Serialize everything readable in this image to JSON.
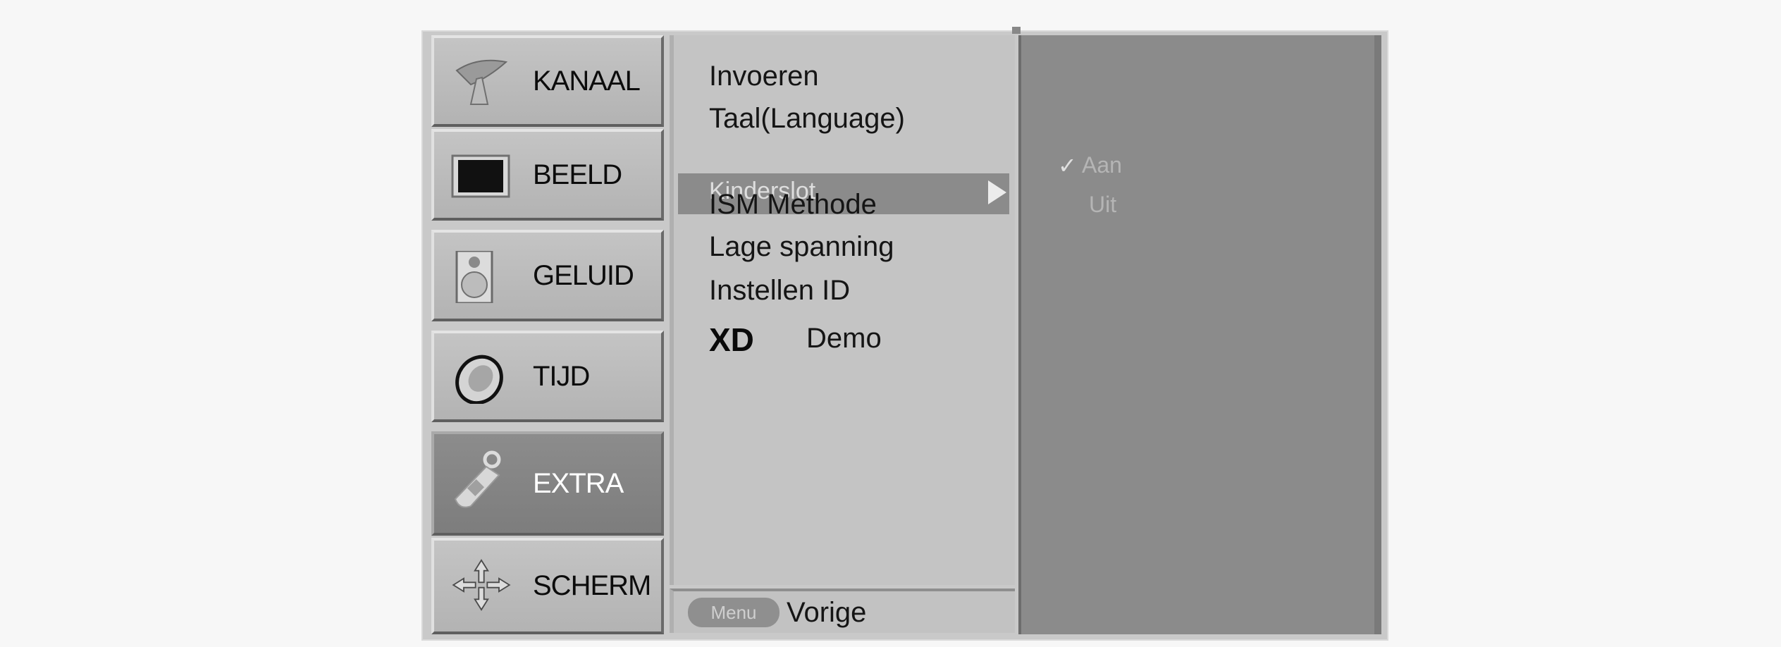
{
  "categories": [
    {
      "label": "KANAAL",
      "icon": "satellite-dish-icon",
      "active": false
    },
    {
      "label": "BEELD",
      "icon": "tv-screen-icon",
      "active": false
    },
    {
      "label": "GELUID",
      "icon": "speaker-icon",
      "active": false
    },
    {
      "label": "TIJD",
      "icon": "clock-icon",
      "active": false
    },
    {
      "label": "EXTRA",
      "icon": "key-tag-icon",
      "active": true
    },
    {
      "label": "SCHERM",
      "icon": "arrows-move-icon",
      "active": false
    }
  ],
  "submenu": {
    "items": [
      {
        "label": "Invoeren"
      },
      {
        "label": "Taal(Language)"
      },
      {
        "label": "Kinderslot",
        "highlighted": true
      },
      {
        "label": "ISM Methode"
      },
      {
        "label": "Lage spanning"
      },
      {
        "label": "Instellen ID"
      },
      {
        "label": "Demo",
        "logo": "XD"
      }
    ]
  },
  "footer": {
    "menu_button": "Menu",
    "back_label": "Vorige"
  },
  "options": {
    "items": [
      {
        "label": "Aan",
        "selected": true
      },
      {
        "label": "Uit",
        "selected": false
      }
    ],
    "check_glyph": "✓"
  },
  "colors": {
    "panel_light": "#c4c4c4",
    "panel_dark": "#8b8b8b",
    "background": "#f7f7f7"
  }
}
